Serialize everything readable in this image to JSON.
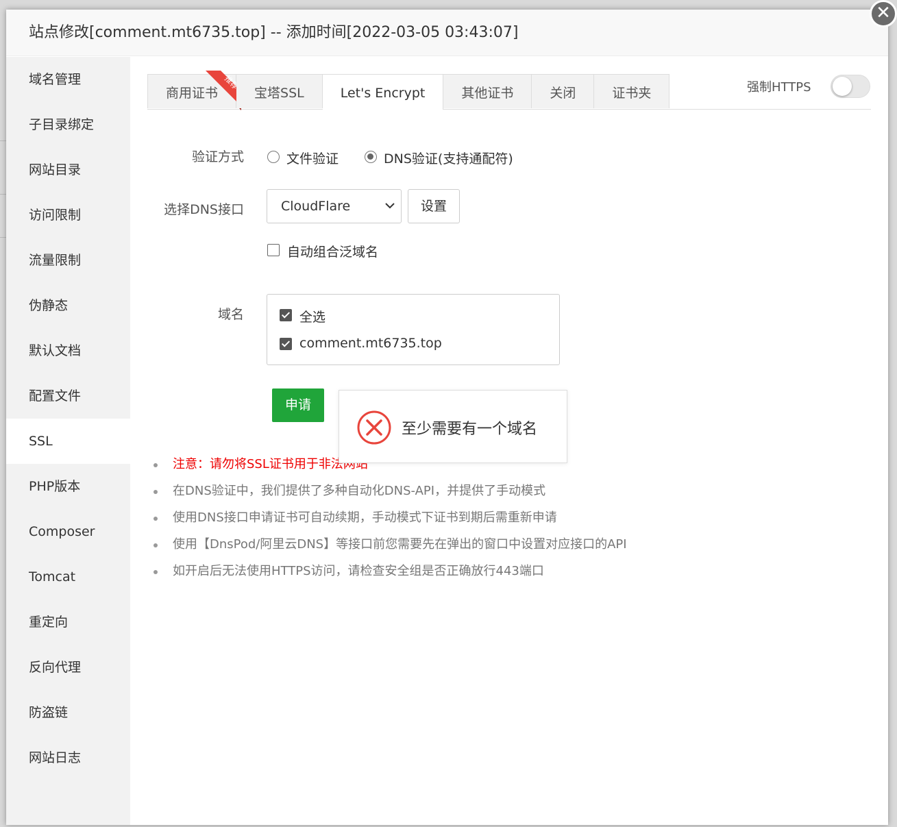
{
  "dialog": {
    "title": "站点修改[comment.mt6735.top] -- 添加时间[2022-03-05 03:43:07]",
    "close_icon": "close-icon"
  },
  "sidebar": {
    "items": [
      {
        "label": "域名管理"
      },
      {
        "label": "子目录绑定"
      },
      {
        "label": "网站目录"
      },
      {
        "label": "访问限制"
      },
      {
        "label": "流量限制"
      },
      {
        "label": "伪静态"
      },
      {
        "label": "默认文档"
      },
      {
        "label": "配置文件"
      },
      {
        "label": "SSL",
        "active": true
      },
      {
        "label": "PHP版本"
      },
      {
        "label": "Composer"
      },
      {
        "label": "Tomcat"
      },
      {
        "label": "重定向"
      },
      {
        "label": "反向代理"
      },
      {
        "label": "防盗链"
      },
      {
        "label": "网站日志"
      }
    ]
  },
  "tabs": [
    {
      "label": "商用证书",
      "badge": "推荐"
    },
    {
      "label": "宝塔SSL"
    },
    {
      "label": "Let's Encrypt",
      "active": true
    },
    {
      "label": "其他证书"
    },
    {
      "label": "关闭"
    },
    {
      "label": "证书夹"
    }
  ],
  "force_https": {
    "label": "强制HTTPS",
    "enabled": false
  },
  "form": {
    "verify_label": "验证方式",
    "verify_options": [
      {
        "label": "文件验证",
        "checked": false
      },
      {
        "label": "DNS验证(支持通配符)",
        "checked": true
      }
    ],
    "dns_label": "选择DNS接口",
    "dns_value": "CloudFlare",
    "settings_button": "设置",
    "auto_wildcard_label": "自动组合泛域名",
    "auto_wildcard_checked": false,
    "domain_label": "域名",
    "domains": [
      {
        "label": "全选",
        "checked": true
      },
      {
        "label": "comment.mt6735.top",
        "checked": true
      }
    ],
    "apply_button": "申请"
  },
  "toast": {
    "message": "至少需要有一个域名",
    "icon": "error-icon",
    "color": "#e8453c"
  },
  "notes": [
    {
      "text": "注意：请勿将SSL证书用于非法网站",
      "highlight": true
    },
    {
      "text": "在DNS验证中，我们提供了多种自动化DNS-API，并提供了手动模式",
      "highlight": false
    },
    {
      "text": "使用DNS接口申请证书可自动续期，手动模式下证书到期后需重新申请",
      "highlight": false
    },
    {
      "text": "使用【DnsPod/阿里云DNS】等接口前您需要先在弹出的窗口中设置对应接口的API",
      "highlight": false
    },
    {
      "text": "如开启后无法使用HTTPS访问，请检查安全组是否正确放行443端口",
      "highlight": false
    }
  ],
  "colors": {
    "primary_green": "#20a53a",
    "warning_red": "#e00000"
  }
}
